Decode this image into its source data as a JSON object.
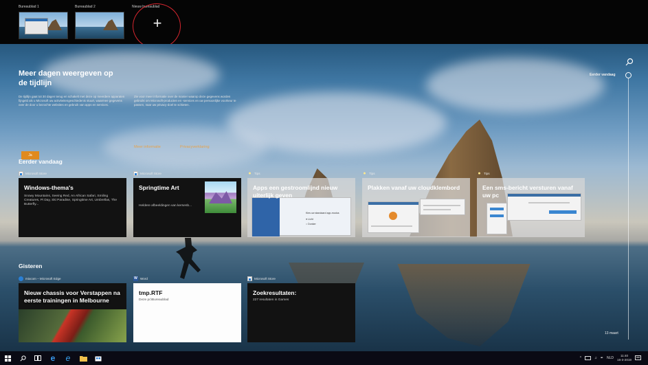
{
  "desktops": [
    {
      "label": "Bureaublad 1"
    },
    {
      "label": "Bureaublad 2"
    },
    {
      "label": "Nieuw bureaublad",
      "glyph": "+"
    }
  ],
  "promo": {
    "title": "Meer dagen weergeven op de tijdlijn",
    "body_1": "De tijdlijn gaat tot 30 dagen terug en schakelt met deze op meerdere apparaten fijngeld als u Microsoft uw activiteitengeschiedenis stuurt, waarmee gegevens over de door u bezochte websites en gebruik van apps en services.",
    "body_2": "Zie voor meer informatie over de manier waarop deze gegevens worden gebruikt om Microsoft-producten en -services en uw persoonlijke voorkeur te passen, naar uw privacy-doel te schieten.",
    "yes_button": "Ja",
    "link_more": "Meer informatie",
    "link_privacy": "Privacyverklaring"
  },
  "scrubber": {
    "top_label": "Eerder vandaag",
    "bottom_label": "13 maart"
  },
  "sections": [
    {
      "heading": "Eerder vandaag",
      "cards": [
        {
          "source": "Microsoft Store",
          "source_icon": "store-icon",
          "title": "Windows-thema's",
          "desc": "Snowy Mountains, Seeing Red, An African Safari, Smiling Creatures, Pi Day, Ski Paradise, Springtime Art, Umbrellas, The Butterfly..."
        },
        {
          "source": "Microsoft Store",
          "source_icon": "store-icon",
          "title": "Springtime Art",
          "desc": "Heldere afbeeldingen van kersenb..."
        },
        {
          "source": "Tips",
          "source_icon": "tips-icon",
          "title": "Apps een gestroomlijnd nieuw uiterlijk geven",
          "mock_text": "Kies uw standaard app-modus",
          "mock_option_1": "Licht",
          "mock_option_2": "Donker"
        },
        {
          "source": "Tips",
          "source_icon": "tips-icon",
          "title": "Plakken vanaf uw cloudklembord"
        },
        {
          "source": "Tips",
          "source_icon": "tips-icon",
          "title": "Een sms-bericht versturen vanaf uw pc"
        }
      ]
    },
    {
      "heading": "Gisteren",
      "cards": [
        {
          "source": "mixcom – Microsoft Edge",
          "source_icon": "edge-icon",
          "title": "Nieuw chassis voor Verstappen na eerste trainingen in Melbourne"
        },
        {
          "source": "Word",
          "source_icon": "word-icon",
          "source_glyph": "W",
          "title": "tmp.RTF",
          "desc": "Deze pc\\Bureaublad"
        },
        {
          "source": "Microsoft Store",
          "source_icon": "store-icon",
          "title": "Zoekresultaten:",
          "desc": "227 resultaten in Games"
        }
      ]
    }
  ],
  "taskbar": {
    "tray_language": "NLD",
    "clock_time": "11:40",
    "clock_date": "16-3-2019"
  },
  "colors": {
    "accent_orange": "#e08a1e",
    "annotation_red": "#d6262f",
    "card_dark": "#121212",
    "taskbar": "#0a0a14"
  }
}
